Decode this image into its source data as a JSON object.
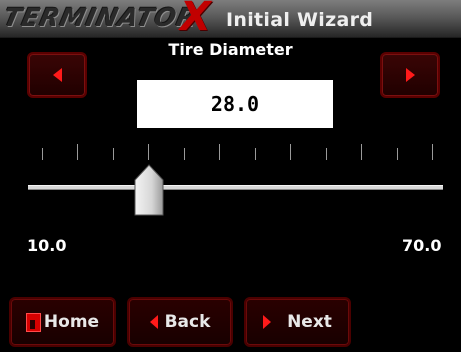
{
  "header": {
    "brand": "TERMINATOR",
    "brand_mark": "X",
    "title": "Initial Wizard"
  },
  "setting": {
    "name": "Tire Diameter",
    "value": "28.0",
    "min": "10.0",
    "max": "70.0"
  },
  "slider": {
    "min": 10,
    "max": 70,
    "current": 28,
    "tick_count": 12
  },
  "nav": {
    "decrease_icon": "left-arrow-icon",
    "increase_icon": "right-arrow-icon"
  },
  "footer": {
    "home_label": "Home",
    "back_label": "Back",
    "next_label": "Next",
    "home_icon": "home-icon",
    "back_icon": "left-arrow-icon",
    "next_icon": "right-arrow-icon"
  },
  "colors": {
    "accent": "#ff1a1a",
    "button_bg": "#200000",
    "background": "#000000"
  }
}
